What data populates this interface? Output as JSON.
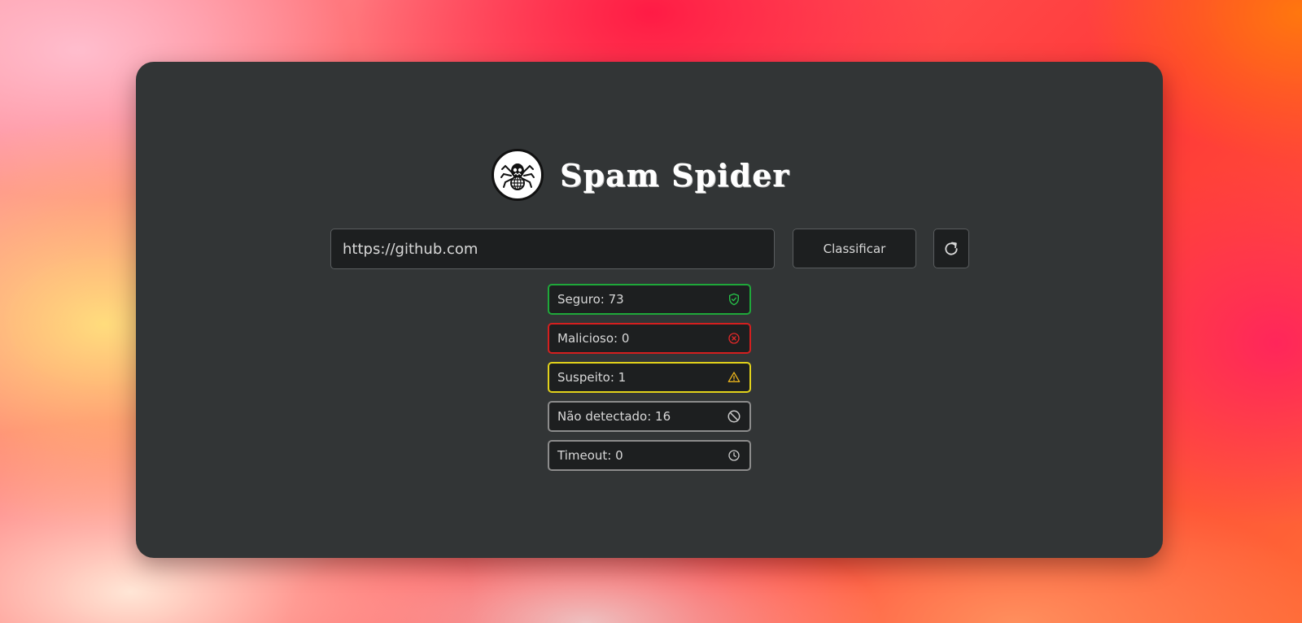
{
  "app": {
    "title": "Spam Spider"
  },
  "form": {
    "url_value": "https://github.com",
    "classify_label": "Classificar",
    "refresh_icon": "refresh-icon"
  },
  "results": [
    {
      "key": "seguro",
      "label": "Seguro: 73",
      "icon": "shield-check-icon",
      "color": "#1fa83a"
    },
    {
      "key": "malicioso",
      "label": "Malicioso: 0",
      "icon": "x-circle-icon",
      "color": "#d41f1f"
    },
    {
      "key": "suspeito",
      "label": "Suspeito: 1",
      "icon": "warning-triangle-icon",
      "color": "#e2d21b"
    },
    {
      "key": "nao-detectado",
      "label": "Não detectado: 16",
      "icon": "ban-icon",
      "color": "#8c8c8c"
    },
    {
      "key": "timeout",
      "label": "Timeout: 0",
      "icon": "clock-icon",
      "color": "#8c8c8c"
    }
  ],
  "colors": {
    "card_background": "#323536",
    "field_background": "#1d1f20",
    "text": "#d8d8d8"
  }
}
